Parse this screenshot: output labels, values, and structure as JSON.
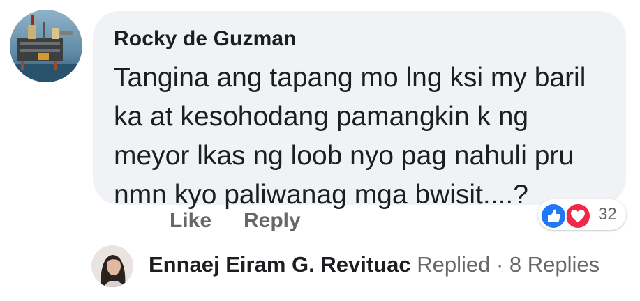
{
  "comment": {
    "author": "Rocky de Guzman",
    "avatar_icon": "oil-rig-avatar",
    "lines": [
      "Tangina ang tapang mo lng ksi my baril",
      "ka at kesohodang pamangkin k ng",
      "meyor lkas ng loob nyo pag nahuli pru",
      "nmn kyo paliwanag mga bwisit....?"
    ],
    "bubble_color": "#f0f2f5"
  },
  "reactions": {
    "types": [
      "like-icon",
      "love-icon"
    ],
    "count": "32",
    "like_color": "#2078f4",
    "love_color": "#f02849"
  },
  "actions": {
    "like_label": "Like",
    "reply_label": "Reply"
  },
  "replies": {
    "replier_name": "Ennaej Eiram G. Revituac",
    "replied_label": " Replied",
    "separator": " · ",
    "count_label": "8 Replies"
  }
}
